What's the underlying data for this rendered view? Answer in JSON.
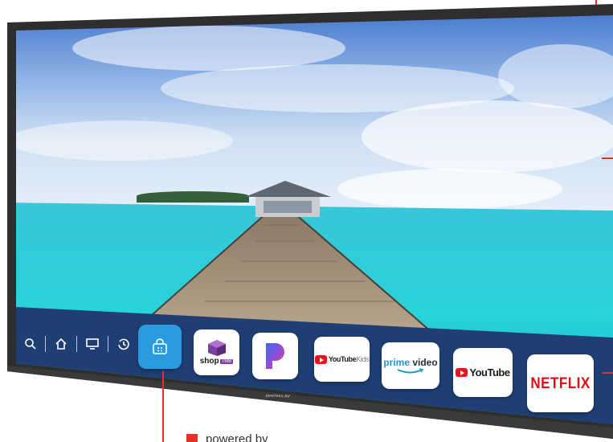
{
  "brand": {
    "label": "peerless-AV"
  },
  "dock": {
    "icons": [
      "search-icon",
      "home-icon",
      "tv-input-icon",
      "history-icon"
    ]
  },
  "apps": {
    "store": {
      "icon": "shopping-bag-icon"
    },
    "shop": {
      "label": "shop",
      "sub": "TMB"
    },
    "pandora": {
      "icon": "pandora-p-icon"
    },
    "youtube_kids": {
      "label": "YouTube",
      "sub": "Kids"
    },
    "prime_video": {
      "label_a": "prime",
      "label_b": "video"
    },
    "youtube": {
      "label": "YouTube"
    },
    "netflix": {
      "label": "NETFLIX"
    }
  },
  "caption": {
    "text": "powered by"
  },
  "colors": {
    "bezel": "#2e2e2e",
    "dock": "#1f3e73",
    "store_tile": "#2b9be0",
    "callout": "#e0312b",
    "netflix": "#e50914",
    "youtube": "#e8151b",
    "prime": "#1a98d5"
  }
}
